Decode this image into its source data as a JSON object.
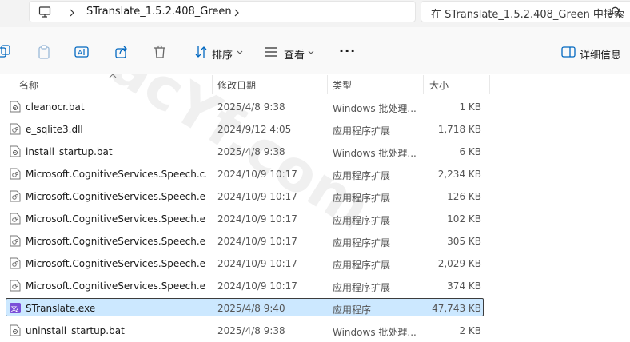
{
  "address": {
    "breadcrumb": "STranslate_1.5.2.408_Green",
    "search_placeholder": "在 STranslate_1.5.2.408_Green 中搜索"
  },
  "toolbar": {
    "sort_label": "排序",
    "view_label": "查看",
    "more_label": "···",
    "details_label": "详细信息"
  },
  "columns": {
    "name": "名称",
    "date": "修改日期",
    "type": "类型",
    "size": "大小"
  },
  "files": [
    {
      "name": "cleanocr.bat",
      "date": "2025/4/8 9:38",
      "type": "Windows 批处理...",
      "size": "1 KB",
      "icon": "batch-file-icon"
    },
    {
      "name": "e_sqlite3.dll",
      "date": "2024/9/12 4:05",
      "type": "应用程序扩展",
      "size": "1,718 KB",
      "icon": "dll-file-icon"
    },
    {
      "name": "install_startup.bat",
      "date": "2025/4/8 9:38",
      "type": "Windows 批处理...",
      "size": "6 KB",
      "icon": "batch-file-icon"
    },
    {
      "name": "Microsoft.CognitiveServices.Speech.c...",
      "date": "2024/10/9 10:17",
      "type": "应用程序扩展",
      "size": "2,234 KB",
      "icon": "dll-file-icon"
    },
    {
      "name": "Microsoft.CognitiveServices.Speech.e...",
      "date": "2024/10/9 10:17",
      "type": "应用程序扩展",
      "size": "126 KB",
      "icon": "dll-file-icon"
    },
    {
      "name": "Microsoft.CognitiveServices.Speech.e...",
      "date": "2024/10/9 10:17",
      "type": "应用程序扩展",
      "size": "102 KB",
      "icon": "dll-file-icon"
    },
    {
      "name": "Microsoft.CognitiveServices.Speech.e...",
      "date": "2024/10/9 10:17",
      "type": "应用程序扩展",
      "size": "305 KB",
      "icon": "dll-file-icon"
    },
    {
      "name": "Microsoft.CognitiveServices.Speech.e...",
      "date": "2024/10/9 10:17",
      "type": "应用程序扩展",
      "size": "2,029 KB",
      "icon": "dll-file-icon"
    },
    {
      "name": "Microsoft.CognitiveServices.Speech.e...",
      "date": "2024/10/9 10:17",
      "type": "应用程序扩展",
      "size": "374 KB",
      "icon": "dll-file-icon"
    },
    {
      "name": "STranslate.exe",
      "date": "2025/4/8 9:40",
      "type": "应用程序",
      "size": "47,743 KB",
      "icon": "stranslate-app-icon",
      "selected": true
    },
    {
      "name": "uninstall_startup.bat",
      "date": "2025/4/8 9:38",
      "type": "Windows 批处理...",
      "size": "2 KB",
      "icon": "batch-file-icon"
    }
  ],
  "watermark": "MacYf.com",
  "colors": {
    "selection_bg": "#cce8ff",
    "accent": "#0067c0"
  }
}
